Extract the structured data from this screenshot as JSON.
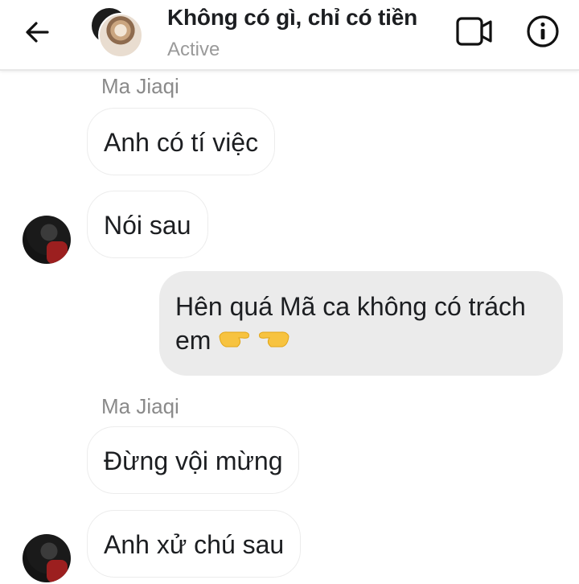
{
  "header": {
    "title": "Không có gì, chỉ có tiền",
    "status": "Active",
    "back_icon": "arrow-left-icon",
    "video_icon": "video-camera-icon",
    "info_icon": "info-icon"
  },
  "messages": [
    {
      "sender": "Ma Jiaqi"
    },
    {
      "text": "Anh có tí việc"
    },
    {
      "text": "Nói sau"
    },
    {
      "text": "Hên quá Mã ca không có trách em",
      "emoji": "👉👈"
    },
    {
      "sender": "Ma Jiaqi"
    },
    {
      "text": "Đừng vội mừng"
    },
    {
      "text": "Anh xử chú sau"
    }
  ],
  "colors": {
    "incoming_border": "#ececec",
    "outgoing_bg": "#ebebeb",
    "status_text": "#9a9a9a",
    "sender_text": "#8a8a8a"
  }
}
